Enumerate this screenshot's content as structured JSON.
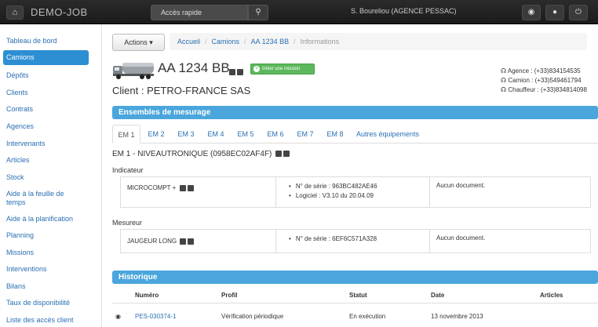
{
  "topbar": {
    "brand": "DEMO-JOB",
    "search_label": "Accès rapide",
    "user": "S. Boureliou (AGENCE PESSAC)",
    "icons": [
      "home-icon",
      "search-icon",
      "globe-icon",
      "user-icon",
      "power-icon"
    ]
  },
  "sidebar": {
    "items": [
      {
        "label": "Tableau de bord"
      },
      {
        "label": "Camions"
      },
      {
        "label": "Dépôts"
      },
      {
        "label": "Clients"
      },
      {
        "label": "Contrats"
      },
      {
        "label": "Agences"
      },
      {
        "label": "Intervenants"
      },
      {
        "label": "Articles"
      },
      {
        "label": "Stock"
      },
      {
        "label": "Aide à la feuille de temps"
      },
      {
        "label": "Aide à la planification"
      },
      {
        "label": "Planning"
      },
      {
        "label": "Missions"
      },
      {
        "label": "Interventions"
      },
      {
        "label": "Bilans"
      },
      {
        "label": "Taux de disponibilité"
      },
      {
        "label": "Liste des accès client"
      }
    ],
    "active_index": 1
  },
  "toolbar": {
    "actions_label": "Actions"
  },
  "breadcrumb": [
    "Accueil",
    "Camions",
    "AA 1234 BB",
    "Informations"
  ],
  "truck": {
    "plate": "AA 1234 BB",
    "mission_button": "Initier une mission",
    "client": "Client : PETRO-FRANCE SAS",
    "contacts": [
      "Agence : (+33)834154535",
      "Camion : (+33)549461794",
      "Chauffeur : (+33)834814098"
    ]
  },
  "ensembles": {
    "title": "Ensembles de mesurage",
    "tabs": [
      "EM 1",
      "EM 2",
      "EM 3",
      "EM 4",
      "EM 5",
      "EM 6",
      "EM 7",
      "EM 8",
      "Autres équipements"
    ],
    "active_tab": 0,
    "heading": "EM 1 - NIVEAUTRONIQUE (0958EC02AF4F)",
    "indicateur": {
      "label": "Indicateur",
      "name": "MICROCOMPT +",
      "details": [
        "N° de série : 963BC482AE46",
        "Logiciel : V3.10 du 20.04.09"
      ],
      "documents": "Aucun document."
    },
    "mesureur": {
      "label": "Mesureur",
      "name": "JAUGEUR LONG",
      "details": [
        "N° de série : 6EF6C571A328"
      ],
      "documents": "Aucun document."
    }
  },
  "historique": {
    "title": "Historique",
    "columns": [
      "Numéro",
      "Profil",
      "Statut",
      "Date",
      "Articles"
    ],
    "rows": [
      {
        "numero": "PES-030374-1",
        "profil": "Vérification périodique",
        "statut": "En exécution",
        "date": "13 novembre 2013",
        "articles": ""
      }
    ]
  }
}
